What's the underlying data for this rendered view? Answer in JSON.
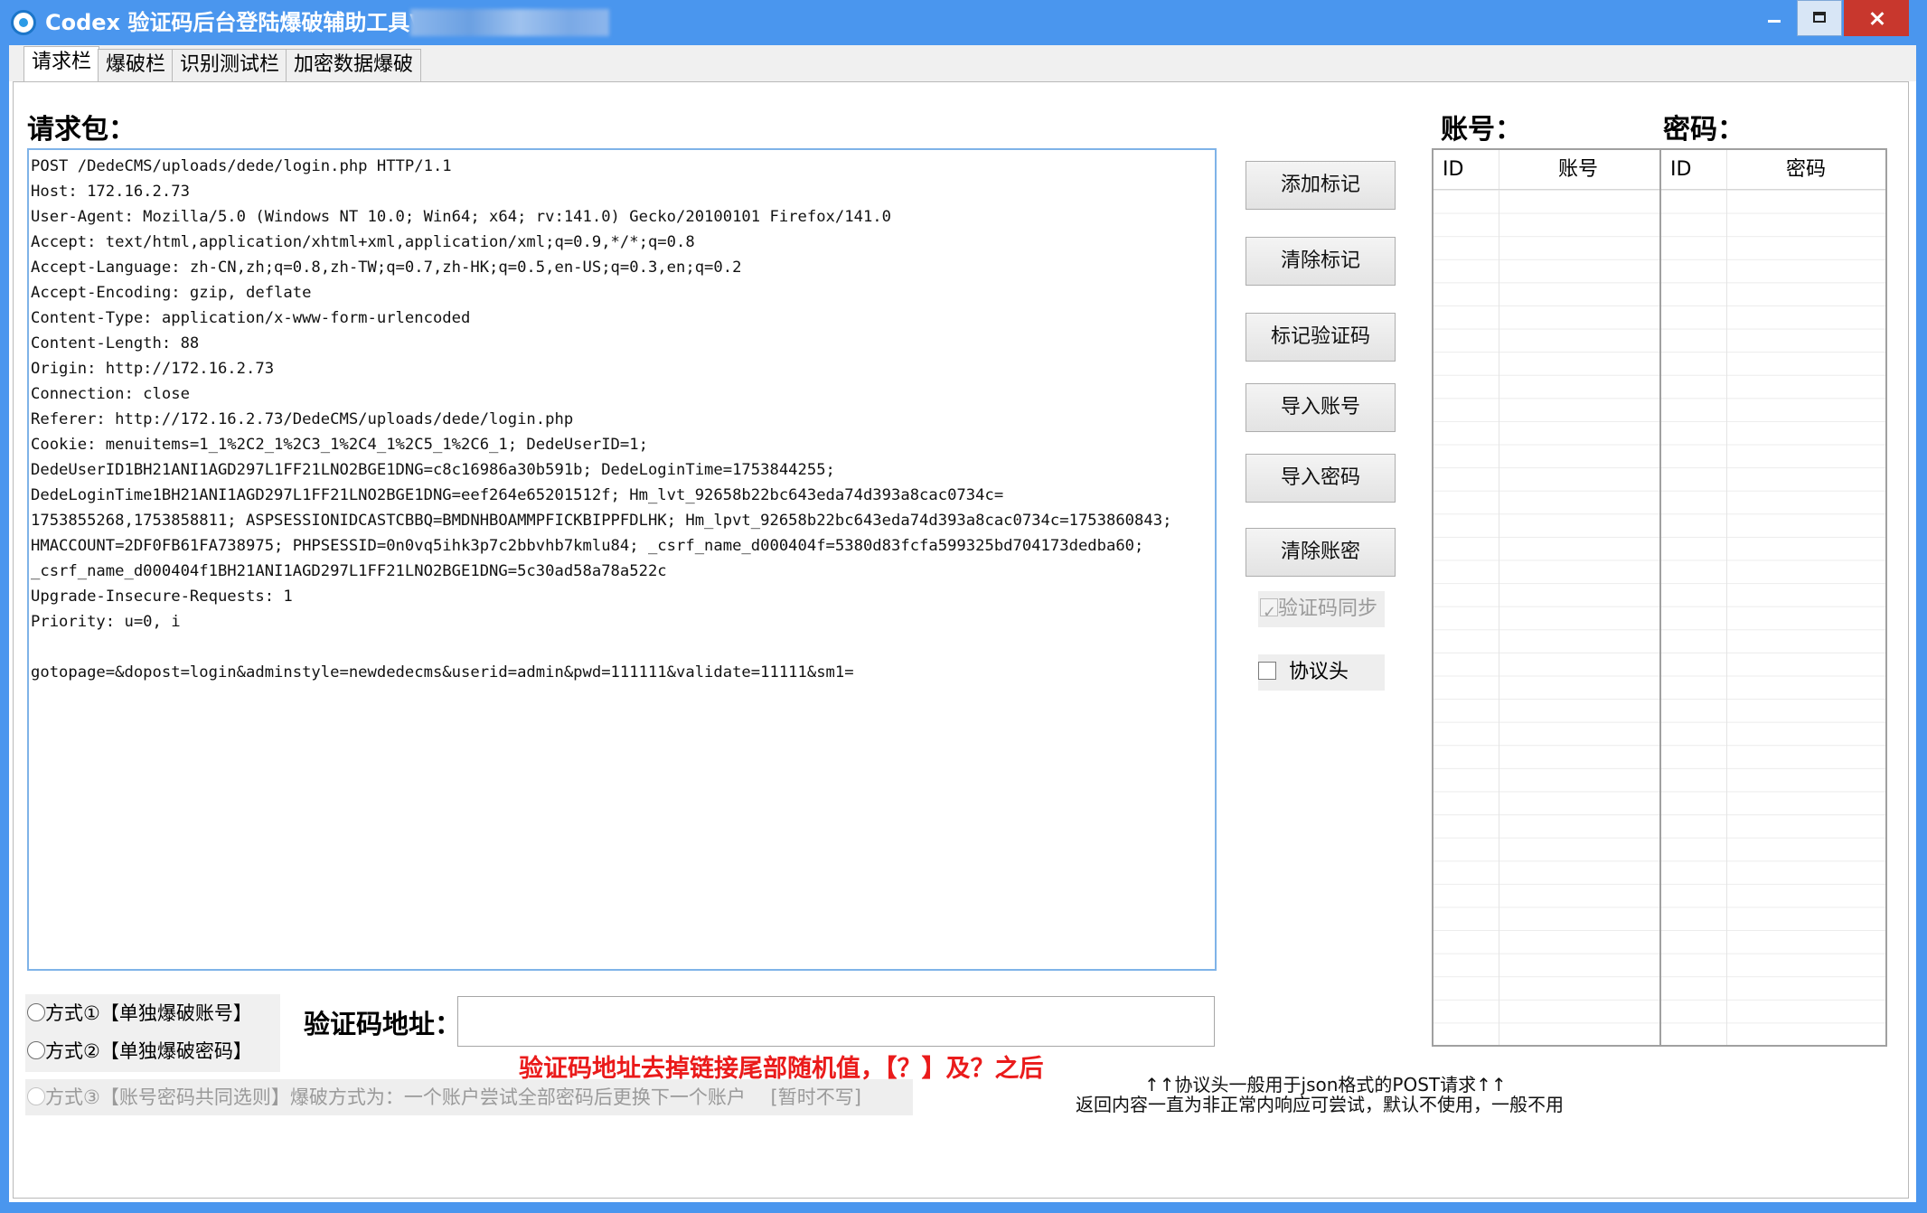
{
  "window": {
    "title": "Codex 验证码后台登陆爆破辅助工具V2.1"
  },
  "tabs": [
    "请求栏",
    "爆破栏",
    "识别测试栏",
    "加密数据爆破"
  ],
  "request": {
    "label": "请求包：",
    "lines": [
      "POST /DedeCMS/uploads/dede/login.php HTTP/1.1",
      "Host: 172.16.2.73",
      "User-Agent: Mozilla/5.0 (Windows NT 10.0; Win64; x64; rv:141.0) Gecko/20100101 Firefox/141.0",
      "Accept: text/html,application/xhtml+xml,application/xml;q=0.9,*/*;q=0.8",
      "Accept-Language: zh-CN,zh;q=0.8,zh-TW;q=0.7,zh-HK;q=0.5,en-US;q=0.3,en;q=0.2",
      "Accept-Encoding: gzip, deflate",
      "Content-Type: application/x-www-form-urlencoded",
      "Content-Length: 88",
      "Origin: http://172.16.2.73",
      "Connection: close",
      "Referer: http://172.16.2.73/DedeCMS/uploads/dede/login.php",
      "Cookie: menuitems=1_1%2C2_1%2C3_1%2C4_1%2C5_1%2C6_1; DedeUserID=1;",
      "DedeUserID1BH21ANI1AGD297L1FF21LNO2BGE1DNG=c8c16986a30b591b; DedeLoginTime=1753844255;",
      "DedeLoginTime1BH21ANI1AGD297L1FF21LNO2BGE1DNG=eef264e65201512f; Hm_lvt_92658b22bc643eda74d393a8cac0734c=",
      "1753855268,1753858811; ASPSESSIONIDCASTCBBQ=BMDNHBOAMMPFICKBIPPFDLHK; Hm_lpvt_92658b22bc643eda74d393a8cac0734c=1753860843;",
      "HMACCOUNT=2DF0FB61FA738975; PHPSESSID=0n0vq5ihk3p7c2bbvhb7kmlu84; _csrf_name_d000404f=5380d83fcfa599325bd704173dedba60;",
      "_csrf_name_d000404f1BH21ANI1AGD297L1FF21LNO2BGE1DNG=5c30ad58a78a522c",
      "Upgrade-Insecure-Requests: 1",
      "Priority: u=0, i",
      "",
      "gotopage=&dopost=login&adminstyle=newdedecms&userid=admin&pwd=111111&validate=11111&sm1="
    ]
  },
  "buttons": {
    "add_mark": "添加标记",
    "clear_mark": "清除标记",
    "mark_captcha": "标记验证码",
    "import_account": "导入账号",
    "import_password": "导入密码",
    "clear_accounts": "清除账密"
  },
  "checks": {
    "captcha_sync": "验证码同步",
    "protocol_header": "协议头"
  },
  "accounts": {
    "label": "账号：",
    "col_id": "ID",
    "col_name": "账号"
  },
  "passwords": {
    "label": "密码：",
    "col_id": "ID",
    "col_name": "密码"
  },
  "modes": {
    "mode1": "方式①【单独爆破账号】",
    "mode2": "方式②【单独爆破密码】",
    "mode3": "方式③【账号密码共同选则】爆破方式为：一个账户尝试全部密码后更换下一个账户　 [暂时不写]"
  },
  "captcha": {
    "label": "验证码地址：",
    "value": "",
    "note": "验证码地址去掉链接尾部随机值，【？】及？之后"
  },
  "protocol_note": {
    "line1": "↑↑协议头一般用于json格式的POST请求↑↑",
    "line2": "返回内容一直为非正常内响应可尝试，默认不使用，一般不用"
  },
  "colors": {
    "titlebar": "#4a96ee",
    "close_button": "#c8372d",
    "request_border": "#7fb3e8",
    "note_red": "#ea1b1b"
  }
}
